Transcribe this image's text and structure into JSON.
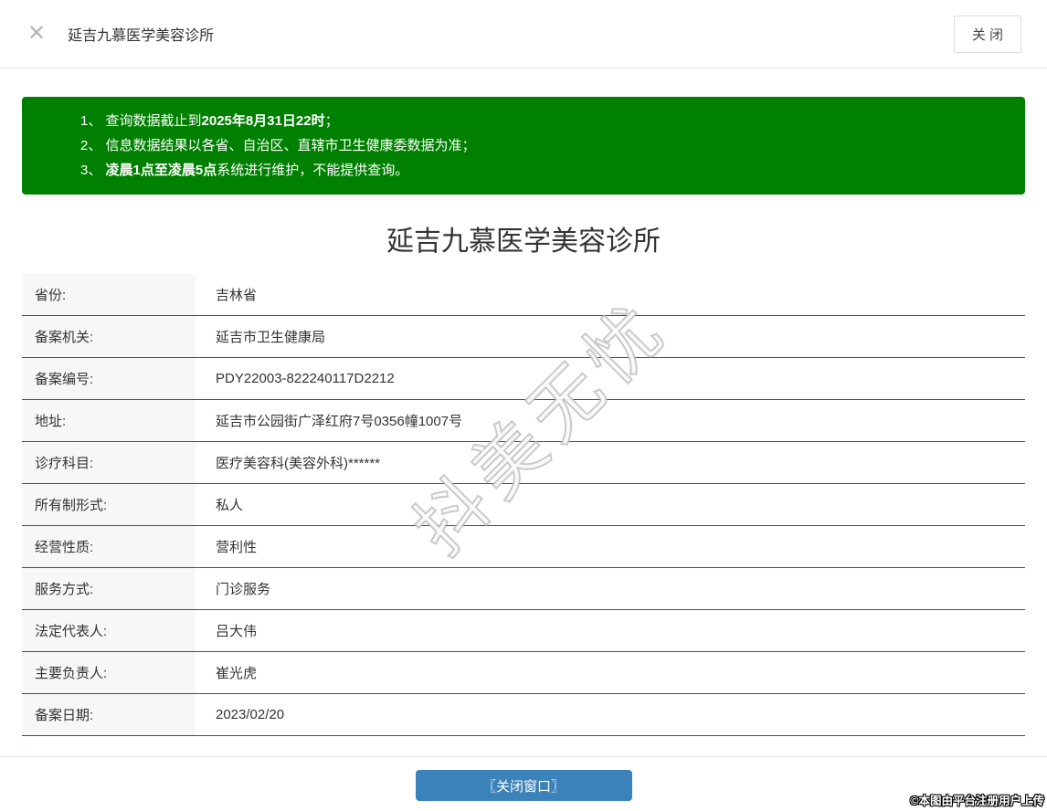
{
  "header": {
    "close_icon": "✕",
    "title": "延吉九慕医学美容诊所",
    "close_button_label": "关 闭"
  },
  "notice": {
    "lines": [
      {
        "pre": "1、 查询数据截止到",
        "bold": "2025年8月31日22时",
        "post": "；"
      },
      {
        "pre": "2、 信息数据结果以各省、自治区、直辖市卫生健康委数据为准；",
        "bold": "",
        "post": ""
      },
      {
        "pre": "3、 ",
        "bold": "凌晨1点至凌晨5点",
        "post": "系统进行维护，不能提供查询。"
      }
    ]
  },
  "clinic": {
    "name": "延吉九慕医学美容诊所"
  },
  "details": {
    "rows": [
      {
        "label": "省份:",
        "value": "吉林省"
      },
      {
        "label": "备案机关:",
        "value": "延吉市卫生健康局"
      },
      {
        "label": "备案编号:",
        "value": "PDY22003-822240117D2212"
      },
      {
        "label": "地址:",
        "value": "延吉市公园街广泽红府7号0356幢1007号"
      },
      {
        "label": "诊疗科目:",
        "value": "医疗美容科(美容外科)******"
      },
      {
        "label": "所有制形式:",
        "value": "私人"
      },
      {
        "label": "经营性质:",
        "value": "营利性"
      },
      {
        "label": "服务方式:",
        "value": "门诊服务"
      },
      {
        "label": "法定代表人:",
        "value": "吕大伟"
      },
      {
        "label": "主要负责人:",
        "value": "崔光虎"
      },
      {
        "label": "备案日期:",
        "value": "2023/02/20"
      }
    ]
  },
  "watermark": "抖美无忧",
  "footer": {
    "close_window_button_label": "〖关闭窗口〗"
  },
  "attribution": "©本图由平台注册用户上传",
  "colors": {
    "notice_green": "#008000",
    "row_border_teal": "#265f52",
    "button_blue": "#3c82ba",
    "label_cell_bg": "#f7f7f7"
  }
}
